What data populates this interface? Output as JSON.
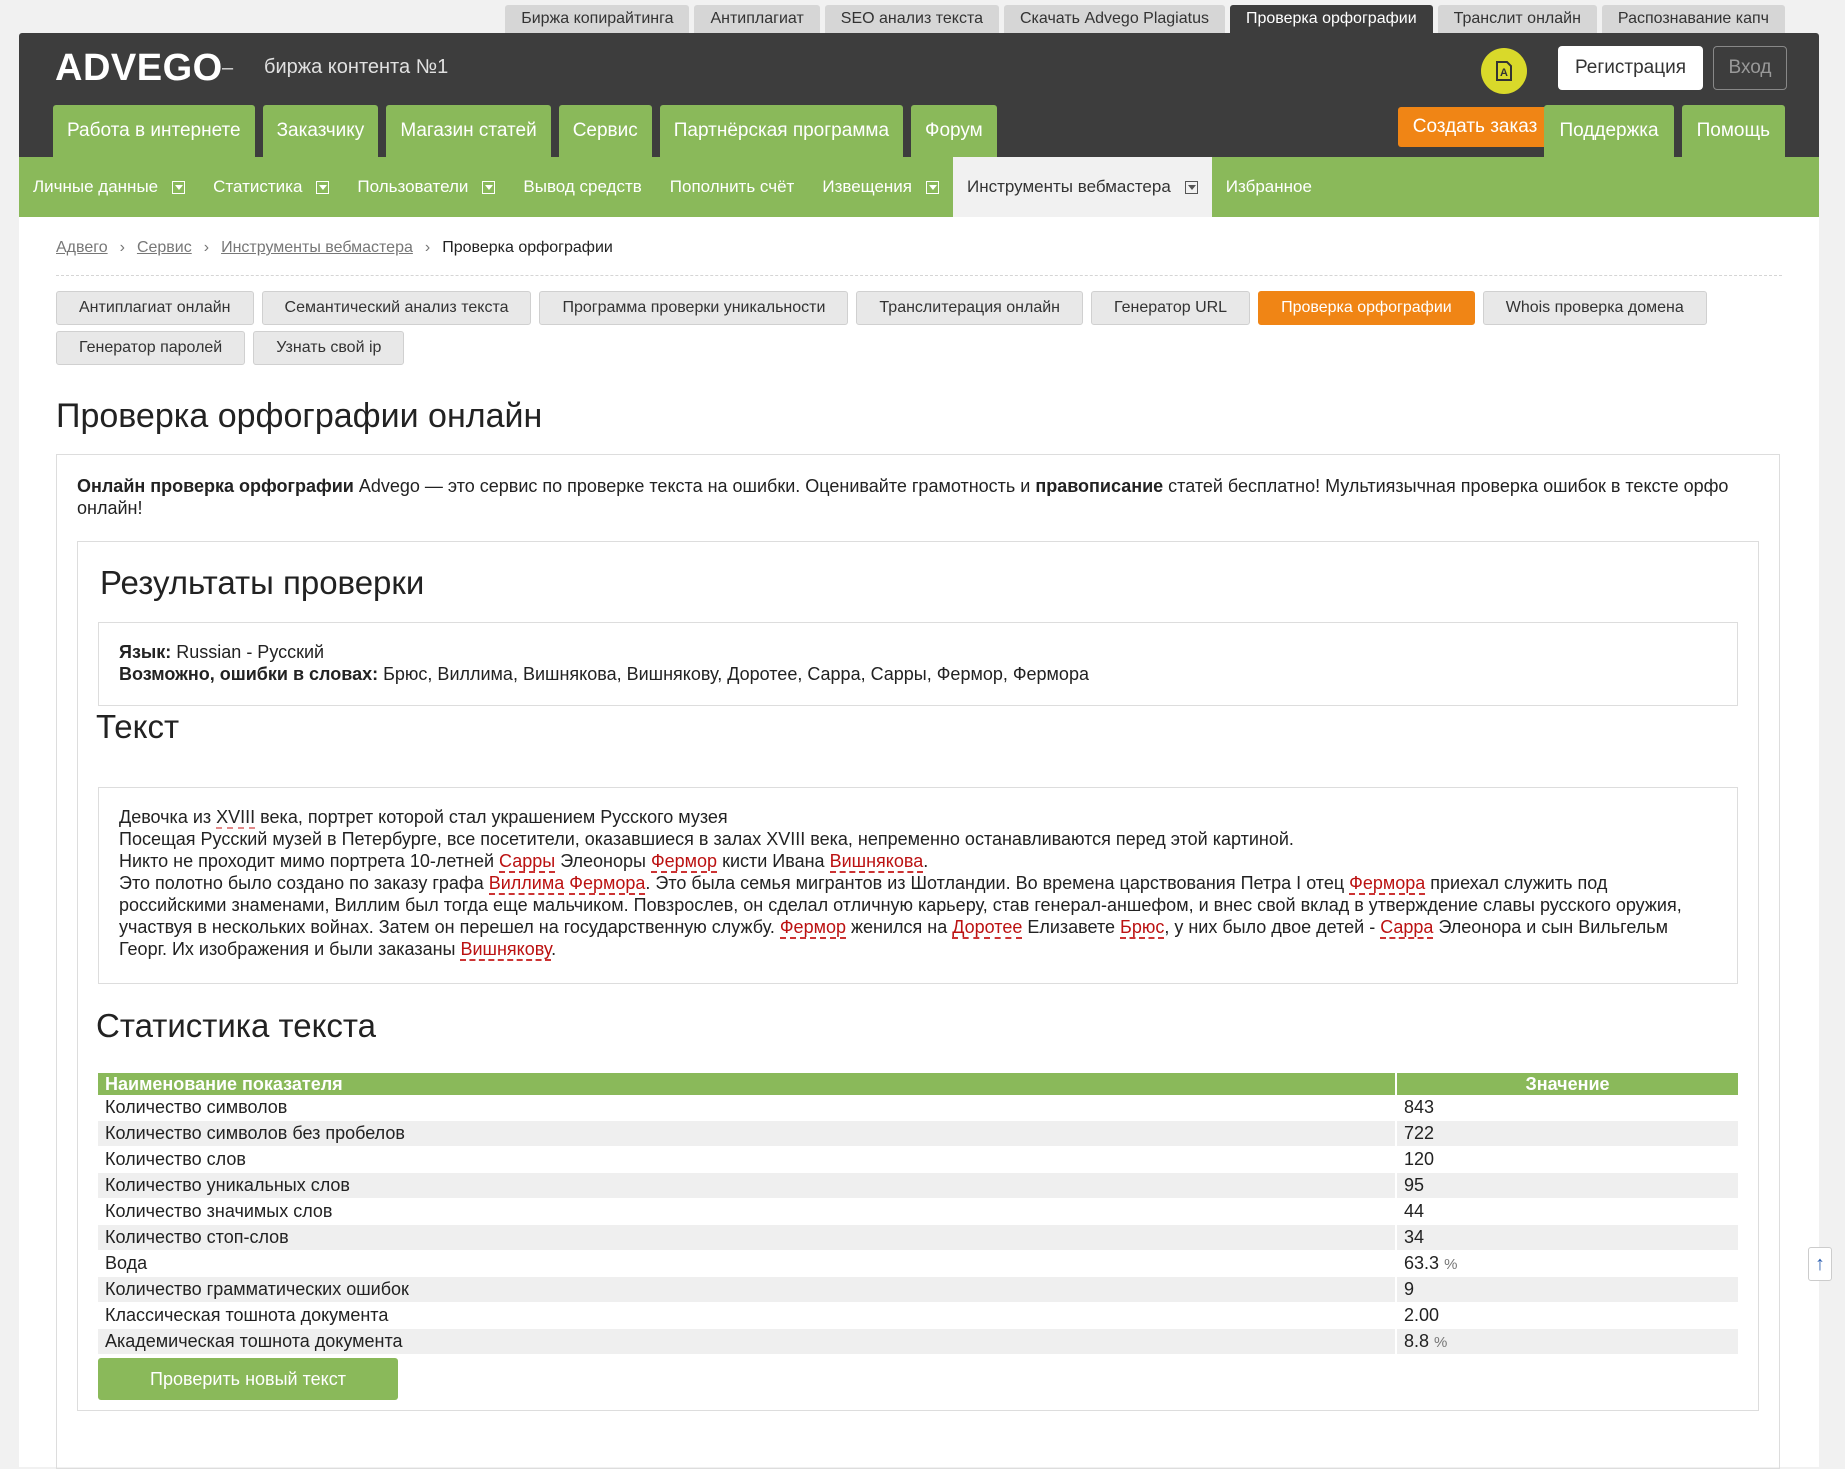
{
  "service_tabs": [
    {
      "label": "Биржа копирайтинга",
      "active": false
    },
    {
      "label": "Антиплагиат",
      "active": false
    },
    {
      "label": "SEO анализ текста",
      "active": false
    },
    {
      "label": "Скачать Advego Plagiatus",
      "active": false
    },
    {
      "label": "Проверка орфографии",
      "active": true
    },
    {
      "label": "Транслит онлайн",
      "active": false
    },
    {
      "label": "Распознавание капч",
      "active": false
    }
  ],
  "header": {
    "logo": "ADVEGO",
    "dash": "–",
    "tagline": "биржа контента №1",
    "register_label": "Регистрация",
    "login_label": "Вход",
    "badge_icon": "advego-a-icon",
    "badge_color": "#d9d92a"
  },
  "main_nav": [
    "Работа в интернете",
    "Заказчику",
    "Магазин статей",
    "Сервис",
    "Партнёрская программа",
    "Форум"
  ],
  "main_nav_active": "Сервис",
  "create_order_label": "Создать заказ",
  "right_nav": [
    "Поддержка",
    "Помощь"
  ],
  "sub_nav": {
    "items": [
      {
        "label": "Личные данные",
        "dropdown": true
      },
      {
        "label": "Статистика",
        "dropdown": true
      },
      {
        "label": "Пользователи",
        "dropdown": true
      },
      {
        "label": "Вывод средств",
        "dropdown": false
      },
      {
        "label": "Пополнить счёт",
        "dropdown": false
      },
      {
        "label": "Извещения",
        "dropdown": true
      },
      {
        "label": "Инструменты вебмастера",
        "dropdown": true
      },
      {
        "label": "Избранное",
        "dropdown": false
      }
    ],
    "active": "Инструменты вебмастера"
  },
  "breadcrumb": {
    "links": [
      "Адвего",
      "Сервис",
      "Инструменты вебмастера"
    ],
    "current": "Проверка орфографии",
    "separator": "›"
  },
  "tools": [
    {
      "label": "Антиплагиат онлайн",
      "active": false
    },
    {
      "label": "Семантический анализ текста",
      "active": false
    },
    {
      "label": "Программа проверки уникальности",
      "active": false
    },
    {
      "label": "Транслитерация онлайн",
      "active": false
    },
    {
      "label": "Генератор URL",
      "active": false
    },
    {
      "label": "Проверка орфографии",
      "active": true
    },
    {
      "label": "Whois проверка домена",
      "active": false
    },
    {
      "label": "Генератор паролей",
      "active": false
    },
    {
      "label": "Узнать свой ip",
      "active": false
    }
  ],
  "page_title": "Проверка орфографии онлайн",
  "intro": {
    "bold1": "Онлайн проверка орфографии",
    "text1": " Advego — это сервис по проверке текста на ошибки. Оценивайте грамотность и ",
    "bold2": "правописание",
    "text2": " статей бесплатно! Мультиязычная проверка ошибок в тексте орфо онлайн!"
  },
  "results": {
    "title": "Результаты проверки",
    "language_label": "Язык:",
    "language_value": "Russian - Русский",
    "errors_label": "Возможно, ошибки в словах:",
    "errors_value": "Брюс, Виллима, Вишнякова, Вишнякову, Доротее, Сарра, Сарры, Фермор, Фермора"
  },
  "text_section": {
    "title": "Текст",
    "segments": [
      {
        "t": "Девочка из "
      },
      {
        "t": "XVIII",
        "k": "warn"
      },
      {
        "t": " века, портрет которой стал украшением Русского музея\n"
      },
      {
        "t": "Посещая Русский музей в Петербурге, все посетители, оказавшиеся в залах XVIII века, непременно останавливаются перед этой картиной.\n"
      },
      {
        "t": "Никто не проходит мимо портрета 10-летней "
      },
      {
        "t": "Сарры",
        "k": "err"
      },
      {
        "t": " Элеоноры "
      },
      {
        "t": "Фермор",
        "k": "err"
      },
      {
        "t": " кисти Ивана "
      },
      {
        "t": "Вишнякова",
        "k": "err"
      },
      {
        "t": ".\n"
      },
      {
        "t": "Это полотно было создано по заказу графа "
      },
      {
        "t": "Виллима",
        "k": "err"
      },
      {
        "t": " "
      },
      {
        "t": "Фермора",
        "k": "err"
      },
      {
        "t": ". Это была семья мигрантов из Шотландии. Во времена царствования Петра I отец "
      },
      {
        "t": "Фермора",
        "k": "err"
      },
      {
        "t": " приехал служить под российскими знаменами, Виллим был тогда еще мальчиком. Повзрослев, он сделал отличную карьеру, став генерал-аншефом, и внес свой вклад в утверждение славы русского оружия, участвуя в нескольких войнах. Затем он перешел на государственную службу. "
      },
      {
        "t": "Фермор",
        "k": "err"
      },
      {
        "t": " женился на "
      },
      {
        "t": "Доротее",
        "k": "err"
      },
      {
        "t": " Елизавете "
      },
      {
        "t": "Брюс",
        "k": "err"
      },
      {
        "t": ", у них было двое детей - "
      },
      {
        "t": "Сарра",
        "k": "err"
      },
      {
        "t": " Элеонора и сын Вильгельм Георг. Их изображения и были заказаны "
      },
      {
        "t": "Вишнякову",
        "k": "err"
      },
      {
        "t": "."
      }
    ]
  },
  "stats": {
    "title": "Статистика текста",
    "col_name": "Наименование показателя",
    "col_value": "Значение",
    "rows": [
      {
        "name": "Количество символов",
        "value": "843",
        "unit": ""
      },
      {
        "name": "Количество символов без пробелов",
        "value": "722",
        "unit": ""
      },
      {
        "name": "Количество слов",
        "value": "120",
        "unit": ""
      },
      {
        "name": "Количество уникальных слов",
        "value": "95",
        "unit": ""
      },
      {
        "name": "Количество значимых слов",
        "value": "44",
        "unit": ""
      },
      {
        "name": "Количество стоп-слов",
        "value": "34",
        "unit": ""
      },
      {
        "name": "Вода",
        "value": "63.3",
        "unit": "%"
      },
      {
        "name": "Количество грамматических ошибок",
        "value": "9",
        "unit": ""
      },
      {
        "name": "Классическая тошнота документа",
        "value": "2.00",
        "unit": ""
      },
      {
        "name": "Академическая тошнота документа",
        "value": "8.8",
        "unit": "%"
      }
    ]
  },
  "check_new_label": "Проверить новый текст",
  "scroll_up_glyph": "↑",
  "colors": {
    "green": "#8ab95a",
    "orange": "#f08515",
    "dark": "#3d3d3d",
    "error": "#b11"
  }
}
